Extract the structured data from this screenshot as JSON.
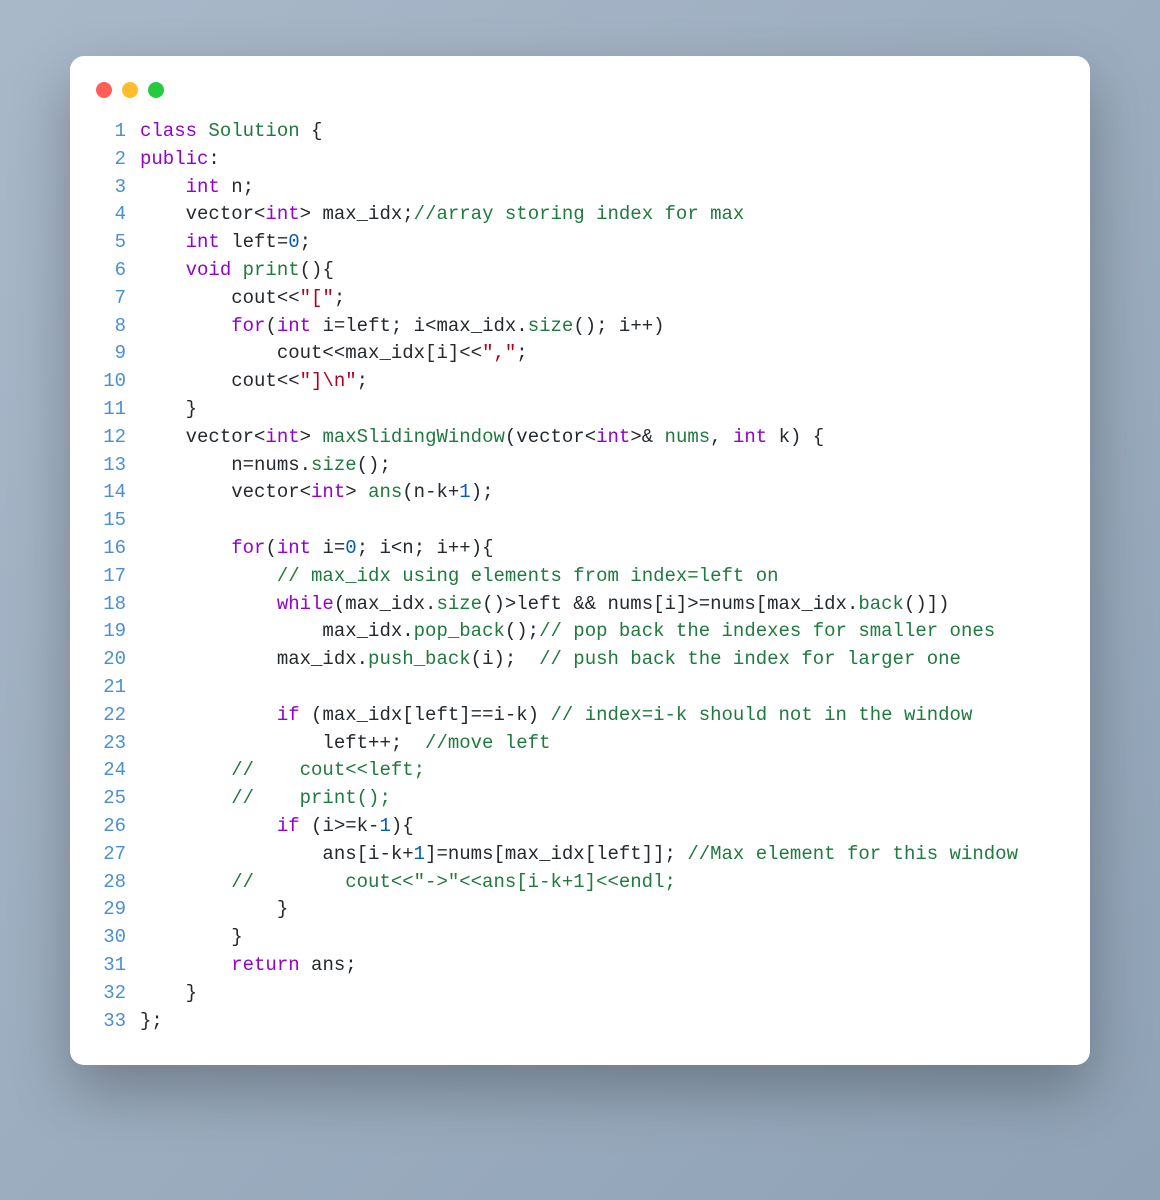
{
  "window": {
    "total_lines": 33
  },
  "code": {
    "lines": [
      [
        {
          "t": "class ",
          "c": "kw"
        },
        {
          "t": "Solution",
          "c": "fn"
        },
        {
          "t": " {"
        }
      ],
      [
        {
          "t": "public",
          "c": "kw"
        },
        {
          "t": ":"
        }
      ],
      [
        {
          "t": "    "
        },
        {
          "t": "int",
          "c": "kw"
        },
        {
          "t": " n;"
        }
      ],
      [
        {
          "t": "    vector<"
        },
        {
          "t": "int",
          "c": "kw"
        },
        {
          "t": "> max_idx;"
        },
        {
          "t": "//array storing index for max",
          "c": "cmt"
        }
      ],
      [
        {
          "t": "    "
        },
        {
          "t": "int",
          "c": "kw"
        },
        {
          "t": " left="
        },
        {
          "t": "0",
          "c": "num"
        },
        {
          "t": ";"
        }
      ],
      [
        {
          "t": "    "
        },
        {
          "t": "void",
          "c": "kw"
        },
        {
          "t": " "
        },
        {
          "t": "print",
          "c": "fn"
        },
        {
          "t": "(){"
        }
      ],
      [
        {
          "t": "        cout<<"
        },
        {
          "t": "\"[\"",
          "c": "str"
        },
        {
          "t": ";"
        }
      ],
      [
        {
          "t": "        "
        },
        {
          "t": "for",
          "c": "kw"
        },
        {
          "t": "("
        },
        {
          "t": "int",
          "c": "kw"
        },
        {
          "t": " i=left; i<max_idx."
        },
        {
          "t": "size",
          "c": "fn"
        },
        {
          "t": "(); i++)"
        }
      ],
      [
        {
          "t": "            cout<<max_idx[i]<<"
        },
        {
          "t": "\",\"",
          "c": "str"
        },
        {
          "t": ";"
        }
      ],
      [
        {
          "t": "        cout<<"
        },
        {
          "t": "\"]\\n\"",
          "c": "str"
        },
        {
          "t": ";"
        }
      ],
      [
        {
          "t": "    }"
        }
      ],
      [
        {
          "t": "    vector<"
        },
        {
          "t": "int",
          "c": "kw"
        },
        {
          "t": "> "
        },
        {
          "t": "maxSlidingWindow",
          "c": "fn"
        },
        {
          "t": "(vector<"
        },
        {
          "t": "int",
          "c": "kw"
        },
        {
          "t": ">& "
        },
        {
          "t": "nums",
          "c": "fn"
        },
        {
          "t": ", "
        },
        {
          "t": "int",
          "c": "kw"
        },
        {
          "t": " k) {"
        }
      ],
      [
        {
          "t": "        n=nums."
        },
        {
          "t": "size",
          "c": "fn"
        },
        {
          "t": "();"
        }
      ],
      [
        {
          "t": "        vector<"
        },
        {
          "t": "int",
          "c": "kw"
        },
        {
          "t": "> "
        },
        {
          "t": "ans",
          "c": "fn"
        },
        {
          "t": "(n-k+"
        },
        {
          "t": "1",
          "c": "num"
        },
        {
          "t": ");"
        }
      ],
      [
        {
          "t": ""
        }
      ],
      [
        {
          "t": "        "
        },
        {
          "t": "for",
          "c": "kw"
        },
        {
          "t": "("
        },
        {
          "t": "int",
          "c": "kw"
        },
        {
          "t": " i="
        },
        {
          "t": "0",
          "c": "num"
        },
        {
          "t": "; i<n; i++){"
        }
      ],
      [
        {
          "t": "            "
        },
        {
          "t": "// max_idx using elements from index=left on",
          "c": "cmt"
        }
      ],
      [
        {
          "t": "            "
        },
        {
          "t": "while",
          "c": "kw"
        },
        {
          "t": "(max_idx."
        },
        {
          "t": "size",
          "c": "fn"
        },
        {
          "t": "()>left && nums[i]>=nums[max_idx."
        },
        {
          "t": "back",
          "c": "fn"
        },
        {
          "t": "()])"
        }
      ],
      [
        {
          "t": "                max_idx."
        },
        {
          "t": "pop_back",
          "c": "fn"
        },
        {
          "t": "();"
        },
        {
          "t": "// pop back the indexes for smaller ones",
          "c": "cmt"
        }
      ],
      [
        {
          "t": "            max_idx."
        },
        {
          "t": "push_back",
          "c": "fn"
        },
        {
          "t": "(i);  "
        },
        {
          "t": "// push back the index for larger one",
          "c": "cmt"
        }
      ],
      [
        {
          "t": ""
        }
      ],
      [
        {
          "t": "            "
        },
        {
          "t": "if",
          "c": "kw"
        },
        {
          "t": " (max_idx[left]==i-k) "
        },
        {
          "t": "// index=i-k should not in the window",
          "c": "cmt"
        }
      ],
      [
        {
          "t": "                left++;  "
        },
        {
          "t": "//move left",
          "c": "cmt"
        }
      ],
      [
        {
          "t": "        "
        },
        {
          "t": "//    cout<<left;",
          "c": "cmt"
        }
      ],
      [
        {
          "t": "        "
        },
        {
          "t": "//    print();",
          "c": "cmt"
        }
      ],
      [
        {
          "t": "            "
        },
        {
          "t": "if",
          "c": "kw"
        },
        {
          "t": " (i>=k-"
        },
        {
          "t": "1",
          "c": "num"
        },
        {
          "t": "){"
        }
      ],
      [
        {
          "t": "                ans[i-k+"
        },
        {
          "t": "1",
          "c": "num"
        },
        {
          "t": "]=nums[max_idx[left]]; "
        },
        {
          "t": "//Max element for this window",
          "c": "cmt"
        }
      ],
      [
        {
          "t": "        "
        },
        {
          "t": "//        cout<<\"->\"<<ans[i-k+1]<<endl;",
          "c": "cmt"
        }
      ],
      [
        {
          "t": "            }"
        }
      ],
      [
        {
          "t": "        }"
        }
      ],
      [
        {
          "t": "        "
        },
        {
          "t": "return",
          "c": "kw"
        },
        {
          "t": " ans;"
        }
      ],
      [
        {
          "t": "    }"
        }
      ],
      [
        {
          "t": "};"
        }
      ]
    ]
  }
}
